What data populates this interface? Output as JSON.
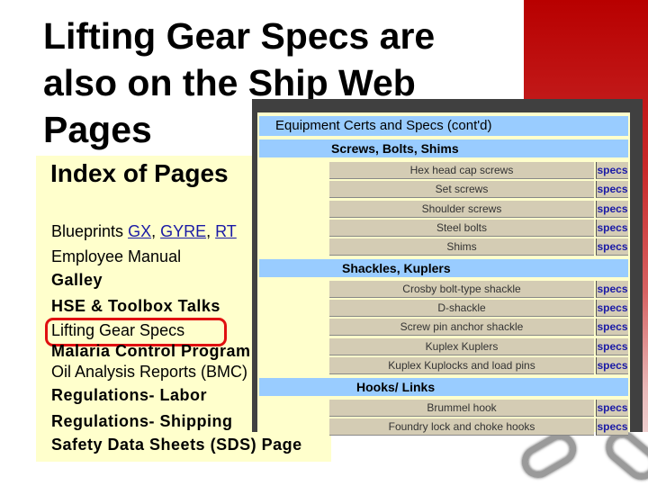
{
  "slide": {
    "title_lines": [
      "Lifting Gear Specs are",
      "also on the Ship Web",
      "Pages"
    ],
    "accent_color": "#b80000"
  },
  "index_panel": {
    "title": "Index of Pages",
    "blueprints_label": "Blueprints",
    "blueprint_links": [
      "GX",
      "GYRE",
      "RT"
    ],
    "items": [
      {
        "label": "Employee Manual",
        "bold": false
      },
      {
        "label": "Galley",
        "bold": true
      },
      {
        "label": "HSE & Toolbox Talks",
        "bold": true
      },
      {
        "label": "Lifting Gear Specs",
        "bold": false,
        "highlighted": true
      },
      {
        "label": "Malaria Control Program",
        "bold": true
      },
      {
        "label": "Oil Analysis Reports (BMC)",
        "bold": false
      },
      {
        "label": "Regulations- Labor",
        "bold": true
      },
      {
        "label": "Regulations- Shipping",
        "bold": true
      },
      {
        "label": "Safety Data Sheets (SDS) Page",
        "bold": true
      }
    ]
  },
  "specs_page": {
    "header": "Equipment Certs and Specs (cont'd)",
    "link_label": "specs",
    "sections": [
      {
        "title": "Screws, Bolts, Shims",
        "items": [
          "Hex head cap screws",
          "Set screws",
          "Shoulder screws",
          "Steel bolts",
          "Shims"
        ]
      },
      {
        "title": "Shackles, Kuplers",
        "items": [
          "Crosby bolt-type shackle",
          "D-shackle",
          "Screw pin anchor shackle",
          "Kuplex Kuplers",
          "Kuplex Kuplocks and load pins"
        ]
      },
      {
        "title": "Hooks/ Links",
        "items": [
          "Brummel hook",
          "Foundry lock and choke hooks"
        ]
      }
    ]
  }
}
